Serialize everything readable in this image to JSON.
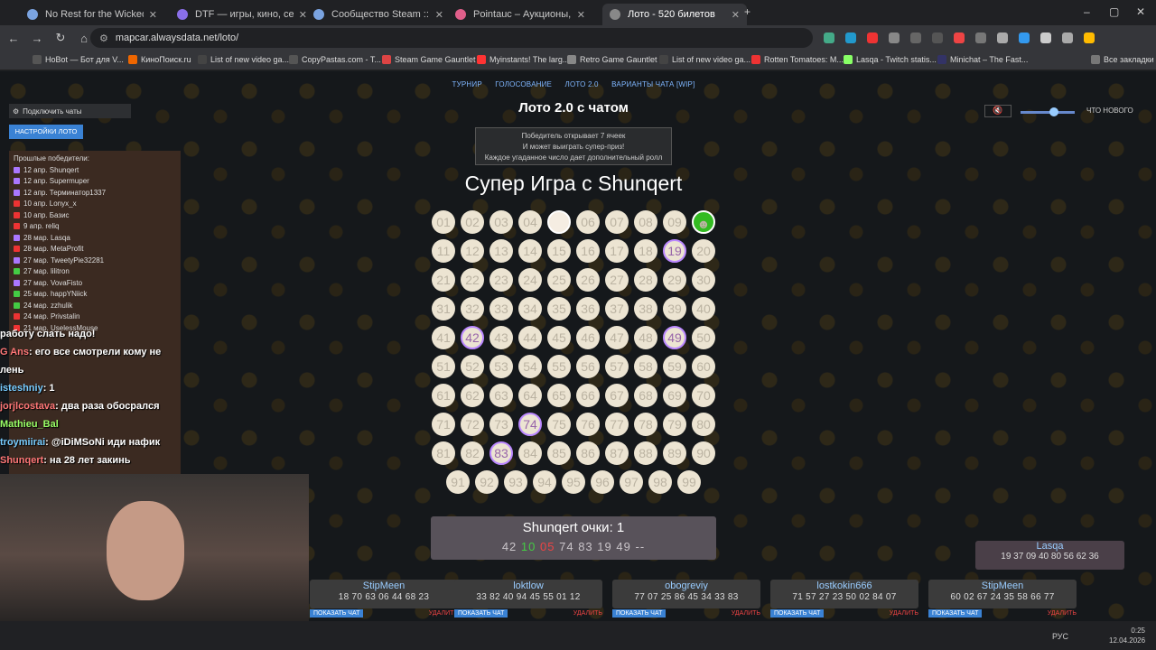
{
  "tabs": [
    {
      "title": "No Rest for the Wicked в Steam",
      "color": "#7aa3e0"
    },
    {
      "title": "DTF — игры, кино, сериалы, р",
      "color": "#8a6fe8"
    },
    {
      "title": "Сообщество Steam :: pleb",
      "color": "#7aa3e0"
    },
    {
      "title": "Pointauc – Аукционы, лотереи",
      "color": "#e05f8a"
    },
    {
      "title": "Лото - 520 билетов",
      "color": "#888"
    }
  ],
  "toolbar": {
    "url": "mapcar.alwaysdata.net/loto/"
  },
  "bookmarks": [
    "НоBot — Бот для V...",
    "КиноПоиск.ru",
    "List of new video ga...",
    "CopyPastas.com - T...",
    "Steam Game Gauntlet",
    "Myinstants! The larg...",
    "Retro Game Gauntlet",
    "List of new video ga...",
    "Rotten Tomatoes: M...",
    "Lasqa - Twitch statis...",
    "Minichat – The Fast...",
    "Все закладки"
  ],
  "nav": {
    "items": [
      "ТУРНИР",
      "ГОЛОСОВАНИЕ",
      "ЛОТО 2.0",
      "ВАРИАНТЫ ЧАТА [WIP]"
    ]
  },
  "loto": {
    "title": "Лото 2.0 с чатом",
    "info": [
      "Победитель открывает 7 ячеек",
      "И может выиграть супер-приз!",
      "Каждое угаданное число дает дополнительный ролл"
    ],
    "game_title": "Супер Игра с Shunqert"
  },
  "board": {
    "hits": [
      "19",
      "42",
      "49",
      "74",
      "83"
    ],
    "favorite": "10",
    "blank": "05"
  },
  "score": {
    "title": "Shunqert очки: 1",
    "numbers": [
      "42",
      "10",
      "05",
      "74",
      "83",
      "19",
      "49",
      "--"
    ]
  },
  "left": {
    "connect": "Подключить чаты",
    "settings": "НАСТРОЙКИ ЛОТО",
    "winners_header": "Прошлые победители:",
    "winners": [
      "12 апр. Shunqert",
      "12 апр. Supermuper",
      "12 апр. Терминатор1337",
      "10 апр. Lonyx_x",
      "10 апр. Базис",
      "9 апр. reliq",
      "28 мар. Lasqa",
      "28 мар. MetaProfit",
      "27 мар. TweetyPie32281",
      "27 мар. lilitron",
      "27 мар. VovaFisto",
      "25 мар. happYNiick",
      "24 мар. zzhulik",
      "24 мар. Privstalin",
      "21 мар. UselessMouse"
    ]
  },
  "chat": [
    {
      "user": "",
      "msg": "работу слать надо!"
    },
    {
      "user": "G Ans",
      "msg": ": его все смотрели кому не"
    },
    {
      "user": "",
      "msg": "лень"
    },
    {
      "user": "isteshniy",
      "msg": ": 1"
    },
    {
      "user": "jorjlcostava",
      "msg": ": два раза обосрался"
    },
    {
      "user": "Mathieu_Bal",
      "msg": ""
    },
    {
      "user": "troymiirai",
      "msg": ": @iDiMSoNi иди нафик"
    },
    {
      "user": "Shunqert",
      "msg": ": на 28 лет закинь"
    }
  ],
  "right": {
    "whats_new": "ЧТО НОВОГО"
  },
  "lasqa": {
    "name": "Lasqa",
    "nums": "19 37 09 40 80 56 62 36"
  },
  "cards": [
    {
      "name": "StipMeen",
      "nums": "18 70 63 06 44 68 23"
    },
    {
      "name": "loktlow",
      "nums": "33 82 40 94 45 55 01 12"
    },
    {
      "name": "obogreviy",
      "nums": "77 07 25 86 45 34 33 83"
    },
    {
      "name": "lostkokin666",
      "nums": "71 57 27 23 50 02 84 07"
    },
    {
      "name": "StipMeen",
      "nums": "60 02 67 24 35 58 66 77"
    }
  ],
  "card_actions": {
    "show": "ПОКАЗАТЬ ЧАТ",
    "delete": "УДАЛИТЬ"
  },
  "taskbar": {
    "lang": "РУС",
    "time": "0:25",
    "date": "12.04.2026"
  }
}
